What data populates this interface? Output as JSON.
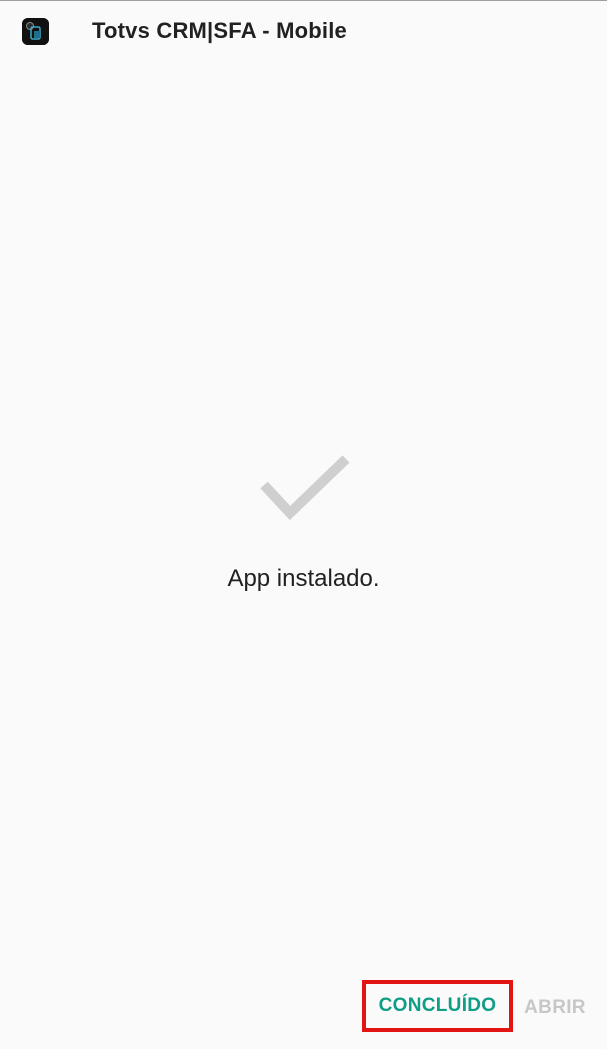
{
  "header": {
    "app_icon": "totvs-app-icon",
    "title": "Totvs CRM|SFA - Mobile"
  },
  "main": {
    "status_icon": "checkmark-icon",
    "status_text": "App instalado."
  },
  "actions": {
    "done_label": "CONCLUÍDO",
    "open_label": "ABRIR"
  },
  "colors": {
    "background": "#fafafa",
    "accent": "#0f9d86",
    "highlight_border": "#e21414",
    "disabled_text": "#c7c7c7",
    "check": "#cfcfcf"
  }
}
